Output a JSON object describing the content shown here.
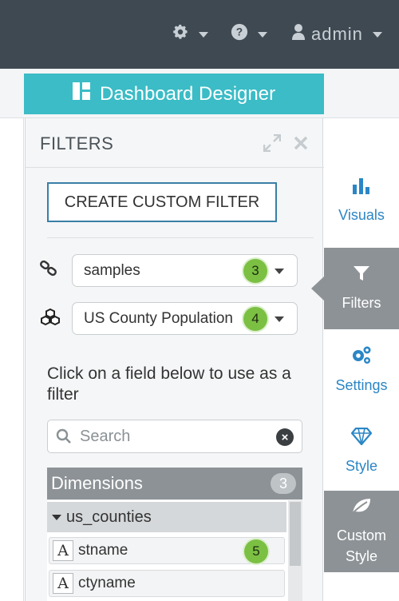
{
  "topbar": {
    "settings_icon": "gear-icon",
    "help_icon": "question-circle-icon",
    "user_icon": "user-icon",
    "user_label": "admin"
  },
  "designer": {
    "icon": "dashboard-icon",
    "label": "Dashboard Designer"
  },
  "filters_panel": {
    "title": "FILTERS",
    "expand_icon": "expand-icon",
    "close_icon": "close-icon",
    "create_button": "CREATE CUSTOM FILTER",
    "connection": {
      "icon": "link-icon",
      "value": "samples",
      "badge": "3"
    },
    "dataset": {
      "icon": "cubes-icon",
      "value": "US County Population",
      "badge": "4"
    },
    "instruction": "Click on a field below to use as a filter",
    "search": {
      "placeholder": "Search",
      "value": ""
    },
    "dimensions": {
      "label": "Dimensions",
      "count": "3",
      "group": "us_counties",
      "fields": [
        {
          "type_icon": "A",
          "name": "stname",
          "badge": "5"
        },
        {
          "type_icon": "A",
          "name": "ctyname"
        }
      ]
    }
  },
  "right_tabs": [
    {
      "icon": "bar-chart-icon",
      "label": "Visuals"
    },
    {
      "icon": "filter-icon",
      "label": "Filters",
      "active": true
    },
    {
      "icon": "cogs-icon",
      "label": "Settings"
    },
    {
      "icon": "diamond-icon",
      "label": "Style"
    },
    {
      "icon": "leaf-icon",
      "label": "Custom Style",
      "line1": "Custom",
      "line2": "Style"
    }
  ],
  "colors": {
    "topbar": "#3e4952",
    "designer_button": "#3bbcc6",
    "accent_blue": "#2b86c5",
    "active_tab": "#8d9296",
    "badge_green": "#7bc043"
  }
}
